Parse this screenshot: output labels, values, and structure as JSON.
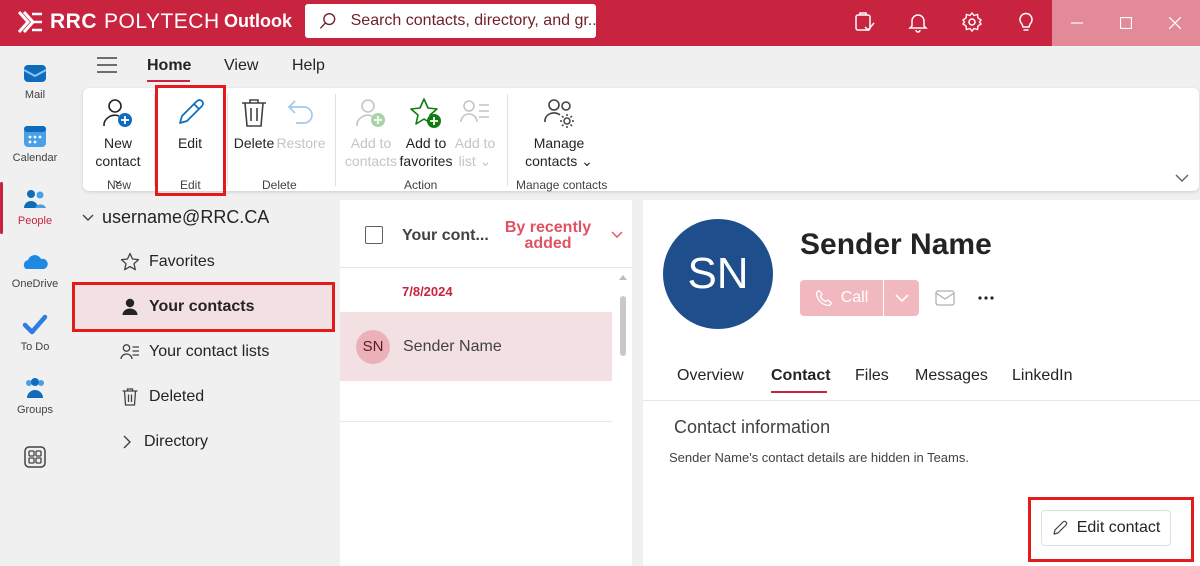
{
  "brand": {
    "name_bold": "RRC",
    "name_rest": "POLYTECH"
  },
  "app_title": "Outlook",
  "search": {
    "placeholder": "Search contacts, directory, and gr..."
  },
  "rail": {
    "items": [
      {
        "label": "Mail",
        "icon": "mail-icon"
      },
      {
        "label": "Calendar",
        "icon": "calendar-icon"
      },
      {
        "label": "People",
        "icon": "people-icon",
        "active": true
      },
      {
        "label": "OneDrive",
        "icon": "onedrive-icon"
      },
      {
        "label": "To Do",
        "icon": "todo-icon"
      },
      {
        "label": "Groups",
        "icon": "groups-icon"
      },
      {
        "label": "",
        "icon": "more-apps-icon"
      }
    ]
  },
  "ribbon_tabs": [
    "Home",
    "View",
    "Help"
  ],
  "ribbon": {
    "new_contact": {
      "line1": "New",
      "line2": "contact"
    },
    "edit": "Edit",
    "delete": "Delete",
    "restore": "Restore",
    "add_to_contacts": {
      "line1": "Add to",
      "line2": "contacts"
    },
    "add_to_favorites": {
      "line1": "Add to",
      "line2": "favorites"
    },
    "add_to_list": {
      "line1": "Add to",
      "line2": "list"
    },
    "manage_contacts": {
      "line1": "Manage",
      "line2": "contacts"
    },
    "groups": {
      "new": "New",
      "edit": "Edit",
      "delete": "Delete",
      "action": "Action",
      "manage": "Manage contacts"
    }
  },
  "folders": {
    "account": "username@RRC.CA",
    "items": [
      {
        "label": "Favorites",
        "icon": "star-icon"
      },
      {
        "label": "Your contacts",
        "icon": "person-icon",
        "active": true
      },
      {
        "label": "Your contact lists",
        "icon": "contact-list-icon"
      },
      {
        "label": "Deleted",
        "icon": "trash-icon"
      }
    ],
    "directory": "Directory"
  },
  "contact_list": {
    "title": "Your cont...",
    "sort_label": "By recently added",
    "date_group": "7/8/2024",
    "contacts": [
      {
        "initials": "SN",
        "name": "Sender Name"
      }
    ]
  },
  "detail": {
    "initials": "SN",
    "name": "Sender Name",
    "call_label": "Call",
    "tabs": [
      "Overview",
      "Contact",
      "Files",
      "Messages",
      "LinkedIn"
    ],
    "active_tab": "Contact",
    "section_title": "Contact information",
    "section_text": "Sender Name's contact details are hidden in Teams.",
    "edit_contact": "Edit contact"
  },
  "colors": {
    "brand": "#c8243f",
    "highlight_box": "#e31b1b",
    "avatar_bg": "#1e4e8c",
    "selected_bg": "#f3e0e3"
  }
}
